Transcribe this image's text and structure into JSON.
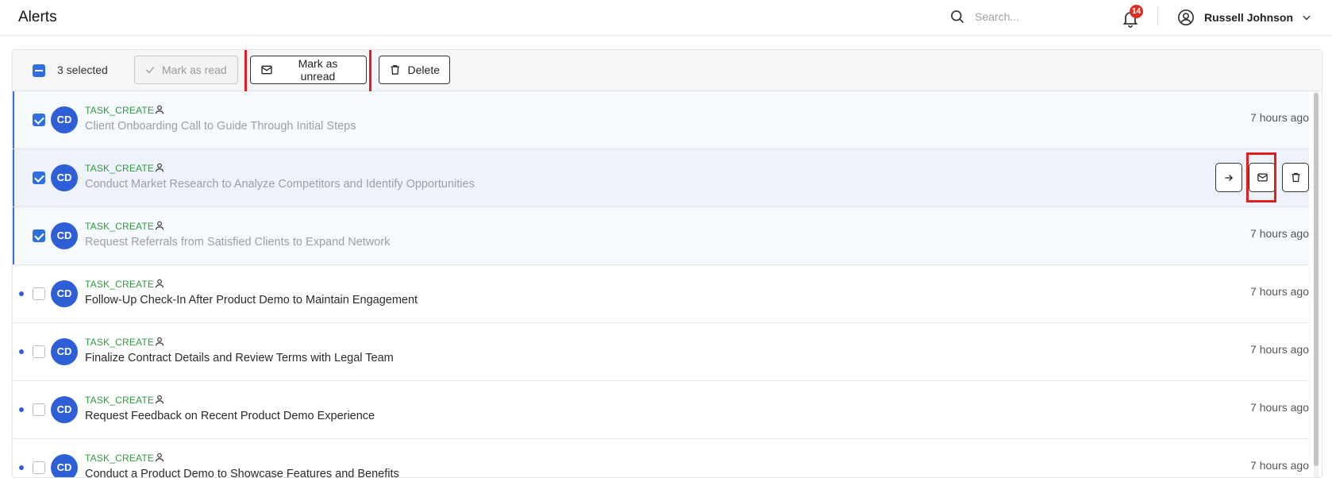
{
  "header": {
    "title": "Alerts",
    "search_placeholder": "Search...",
    "notification_count": "14",
    "user_name": "Russell Johnson"
  },
  "toolbar": {
    "selected_label": "3 selected",
    "mark_read_label": "Mark as read",
    "mark_unread_label": "Mark as unread",
    "delete_label": "Delete"
  },
  "colors": {
    "accent": "#2f6fe0",
    "badge": "#d93025",
    "kind_text": "#2e9a3c",
    "highlight": "#e02020"
  },
  "alerts": [
    {
      "initials": "CD",
      "kind": "TASK_CREATE",
      "title": "Client Onboarding Call to Guide Through Initial Steps",
      "time": "7 hours ago",
      "checked": true,
      "unread": false
    },
    {
      "initials": "CD",
      "kind": "TASK_CREATE",
      "title": "Conduct Market Research to Analyze Competitors and Identify Opportunities",
      "time": "",
      "checked": true,
      "unread": false
    },
    {
      "initials": "CD",
      "kind": "TASK_CREATE",
      "title": "Request Referrals from Satisfied Clients to Expand Network",
      "time": "7 hours ago",
      "checked": true,
      "unread": false
    },
    {
      "initials": "CD",
      "kind": "TASK_CREATE",
      "title": "Follow-Up Check-In After Product Demo to Maintain Engagement",
      "time": "7 hours ago",
      "checked": false,
      "unread": true
    },
    {
      "initials": "CD",
      "kind": "TASK_CREATE",
      "title": "Finalize Contract Details and Review Terms with Legal Team",
      "time": "7 hours ago",
      "checked": false,
      "unread": true
    },
    {
      "initials": "CD",
      "kind": "TASK_CREATE",
      "title": "Request Feedback on Recent Product Demo Experience",
      "time": "7 hours ago",
      "checked": false,
      "unread": true
    },
    {
      "initials": "CD",
      "kind": "TASK_CREATE",
      "title": "Conduct a Product Demo to Showcase Features and Benefits",
      "time": "7 hours ago",
      "checked": false,
      "unread": true
    }
  ],
  "row_action_icons": [
    "arrow-right-icon",
    "envelope-icon",
    "trash-icon"
  ]
}
